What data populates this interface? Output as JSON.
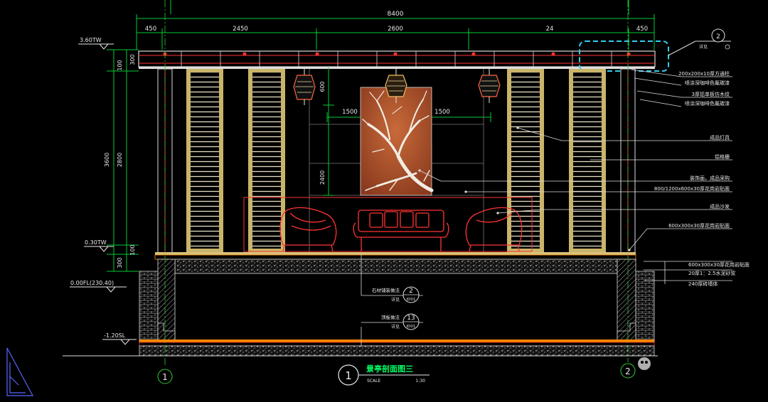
{
  "dimensions": {
    "overall": "8400",
    "top_segments": [
      "450",
      "2450",
      "2600",
      "24",
      "450"
    ],
    "left_segments": [
      "100",
      "300",
      "3600",
      "2800",
      "300",
      "100"
    ],
    "center_width_left": "1500",
    "center_width_right": "1500",
    "artwork_height": "2400",
    "lamp_drop": "600"
  },
  "levels": {
    "roof": "3.60TW",
    "floor": "0.30TW",
    "ground": "0.00FL(230.40)",
    "base": "-1.20SL"
  },
  "callouts": [
    "200x200x10厚方通柱",
    "喷涂深咖啡色氟碳漆",
    "3厚铝单板仿木纹",
    "喷涂深咖啡色氟碳漆",
    "成品灯具",
    "铝格栅",
    "装饰画，成品采购",
    "800/1200x600x30厚花岗岩贴面",
    "成品沙发",
    "600x300x30厚花岗岩贴面",
    "600x300x30厚花岗岩贴面",
    "20厚1：2.5水泥砂浆",
    "240厚砖墙体"
  ],
  "detail_ref": {
    "number": "2",
    "sheet": "详见"
  },
  "section_refs": [
    {
      "label": "石材铺装做法",
      "sub": "详见",
      "number": "2",
      "sheet": "ID01"
    },
    {
      "label": "顶板做法",
      "sub": "详见",
      "number": "13",
      "sheet": "ID01"
    }
  ],
  "grid_axes": [
    "1",
    "2"
  ],
  "title_block": {
    "number": "1",
    "title": "景亭剖面图三",
    "scale_label": "SCALE",
    "scale_value": "1:30"
  },
  "colors": {
    "dimension": "#00cc33",
    "structure": "#ff3333",
    "outline": "#dddddd",
    "louver": "#d9c27a",
    "highlight": "#33ccee",
    "artwork": "#b5522b",
    "title": "#00ff66",
    "axis": "#33cc33",
    "label": "#e8e8e8"
  }
}
